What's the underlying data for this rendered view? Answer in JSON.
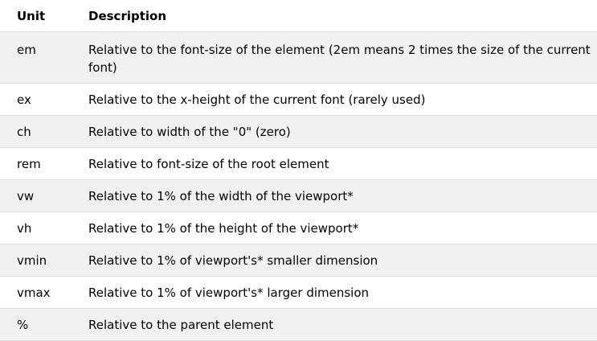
{
  "table": {
    "headers": {
      "unit": "Unit",
      "description": "Description"
    },
    "rows": [
      {
        "unit": "em",
        "description": "Relative to the font-size of the element (2em means 2 times the size of the current font)"
      },
      {
        "unit": "ex",
        "description": "Relative to the x-height of the current font (rarely used)"
      },
      {
        "unit": "ch",
        "description": "Relative to width of the \"0\" (zero)"
      },
      {
        "unit": "rem",
        "description": "Relative to font-size of the root element"
      },
      {
        "unit": "vw",
        "description": "Relative to 1% of the width of the viewport*"
      },
      {
        "unit": "vh",
        "description": "Relative to 1% of the height of the viewport*"
      },
      {
        "unit": "vmin",
        "description": "Relative to 1% of viewport's* smaller dimension"
      },
      {
        "unit": "vmax",
        "description": "Relative to 1% of viewport's* larger dimension"
      },
      {
        "unit": "%",
        "description": "Relative to the parent element"
      }
    ]
  }
}
